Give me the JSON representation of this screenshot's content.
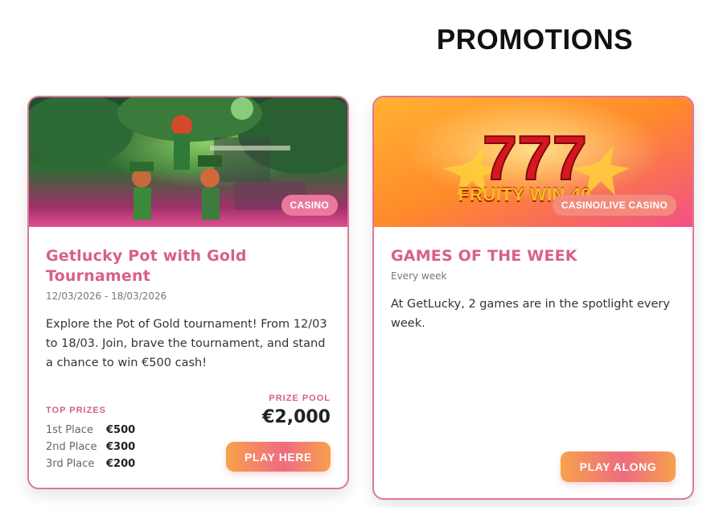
{
  "page": {
    "title": "PROMOTIONS"
  },
  "promotions": [
    {
      "badge": "CASINO",
      "title": "Getlucky Pot with Gold Tournament",
      "dates": "12/03/2026 - 18/03/2026",
      "description": "Explore the Pot of Gold tournament! From 12/03 to 18/03. Join, brave the tournament, and stand a chance to win €500 cash!",
      "prizes_heading": "TOP PRIZES",
      "prizes": [
        {
          "place": "1st Place",
          "amount": "€500"
        },
        {
          "place": "2nd Place",
          "amount": "€300"
        },
        {
          "place": "3rd Place",
          "amount": "€200"
        }
      ],
      "pool_heading": "PRIZE POOL",
      "pool_value": "€2,000",
      "button_label": "PLAY HERE"
    },
    {
      "badge": "CASINO/LIVE CASINO",
      "banner_text": "FRUITY WIN 40",
      "title": "GAMES OF THE WEEK",
      "dates": "Every week",
      "description": "At GetLucky, 2 games are in the spotlight every week.",
      "button_label": "PLAY ALONG"
    }
  ]
}
